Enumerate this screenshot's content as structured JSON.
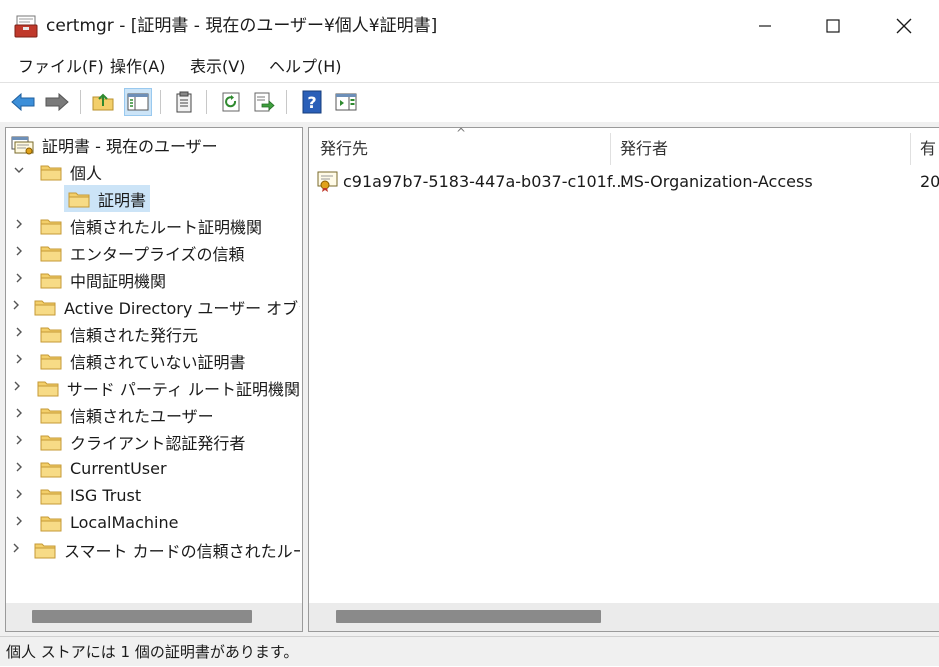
{
  "window": {
    "title": "certmgr - [証明書 - 現在のユーザー¥個人¥証明書]",
    "icon": "certmgr-toolbox-icon",
    "controls": [
      "minimize",
      "maximize",
      "close"
    ]
  },
  "menu": {
    "items": [
      "ファイル(F)",
      "操作(A)",
      "表示(V)",
      "ヘルプ(H)"
    ]
  },
  "toolbar": {
    "buttons": [
      "back-arrow-icon",
      "forward-arrow-icon",
      "up-folder-icon",
      "show-hide-tree-icon",
      "properties-icon",
      "refresh-icon",
      "export-list-icon",
      "help-icon",
      "show-action-pane-icon"
    ]
  },
  "tree": {
    "root": "証明書 - 現在のユーザー",
    "personal": "個人",
    "personal_child": "証明書",
    "folders": [
      "信頼されたルート証明機関",
      "エンタープライズの信頼",
      "中間証明機関",
      "Active Directory ユーザー オブジェ",
      "信頼された発行元",
      "信頼されていない証明書",
      "サード パーティ ルート証明機関",
      "信頼されたユーザー",
      "クライアント認証発行者",
      "CurrentUser",
      "ISG Trust",
      "LocalMachine",
      "スマート カードの信頼されたルート"
    ]
  },
  "list": {
    "columns": [
      "発行先",
      "発行者",
      "有"
    ],
    "sort_indicator": "^",
    "rows": [
      {
        "issued_to": "c91a97b7-5183-447a-b037-c101f...",
        "issued_by": "MS-Organization-Access",
        "expiry": "20"
      }
    ]
  },
  "statusbar": {
    "text": "個人 ストアには 1 個の証明書があります。"
  },
  "colors": {
    "selection": "#cce4f7",
    "folder": "#f3cf6a",
    "help_blue": "#2a5fb8"
  }
}
